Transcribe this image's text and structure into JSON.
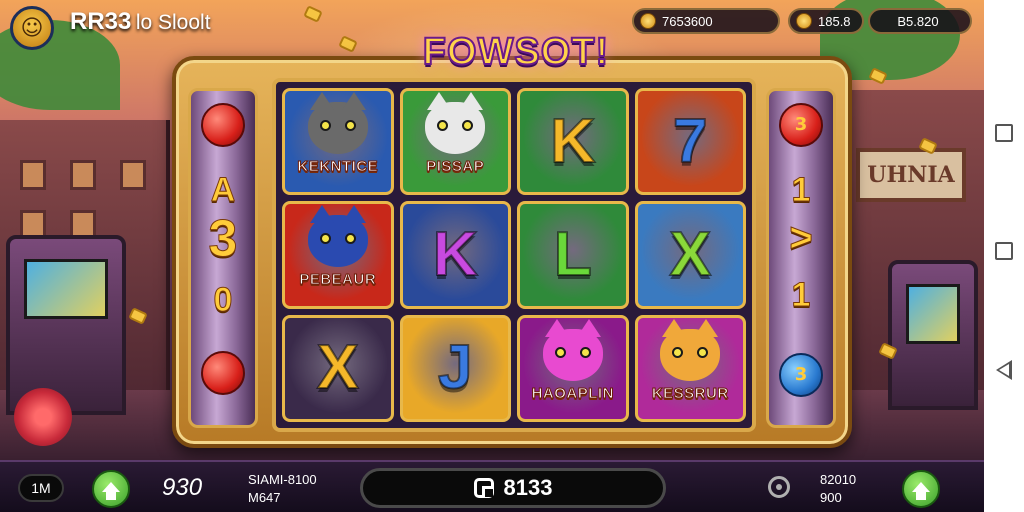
{
  "header": {
    "avatar_icon": "player-avatar-icon",
    "brand_bold": "RR33",
    "brand_rest": "lo Sloolt",
    "stat_1": "7653600",
    "stat_2": "185.8",
    "stat_3": "B5.820"
  },
  "game": {
    "title": "FOWSOT!",
    "left_pillar": [
      "A",
      "3",
      "0"
    ],
    "right_pillar": [
      "3",
      "1",
      ">",
      "1",
      "3"
    ],
    "reels": [
      {
        "kind": "cat",
        "caption": "KEKNTICE",
        "bg": "#2a5ab0",
        "face": "#6a6a6a"
      },
      {
        "kind": "cat",
        "caption": "PISSAP",
        "bg": "#3a9a3a",
        "face": "#e8e8e8"
      },
      {
        "kind": "letter",
        "glyph": "K",
        "bg": "#2f8a3a",
        "color": "#f5b82a"
      },
      {
        "kind": "letter",
        "glyph": "7",
        "bg": "#c8461a",
        "color": "#3a7ae0"
      },
      {
        "kind": "cat",
        "caption": "PEBEAUR",
        "bg": "#c8281a",
        "face": "#2a4ab0"
      },
      {
        "kind": "letter",
        "glyph": "K",
        "bg": "#2a4a9a",
        "color": "#c84ae0"
      },
      {
        "kind": "letter",
        "glyph": "L",
        "bg": "#2f8a3a",
        "color": "#6ad83a"
      },
      {
        "kind": "letter",
        "glyph": "X",
        "bg": "#3a7ac0",
        "color": "#8ad83a"
      },
      {
        "kind": "letter",
        "glyph": "X",
        "bg": "#3a2a4a",
        "color": "#f5b82a"
      },
      {
        "kind": "letter",
        "glyph": "J",
        "bg": "#e8a828",
        "color": "#3a7ae0"
      },
      {
        "kind": "cat",
        "caption": "HAOAPLIN",
        "bg": "#8a1a8a",
        "face": "#e84ad0"
      },
      {
        "kind": "cat",
        "caption": "KESSRUR",
        "bg": "#b02a9a",
        "face": "#f0a83a"
      }
    ]
  },
  "footer": {
    "menu_label": "1M",
    "bet_value": "930",
    "info_line1": "SIAMI-8100",
    "info_line2": "M647",
    "spin_label": "8133",
    "right_line1": "82010",
    "right_line2": "900"
  },
  "colors": {
    "frame_gold": "#d9a84a",
    "title_yellow": "#ffd34a",
    "button_green": "#3aa02a"
  }
}
